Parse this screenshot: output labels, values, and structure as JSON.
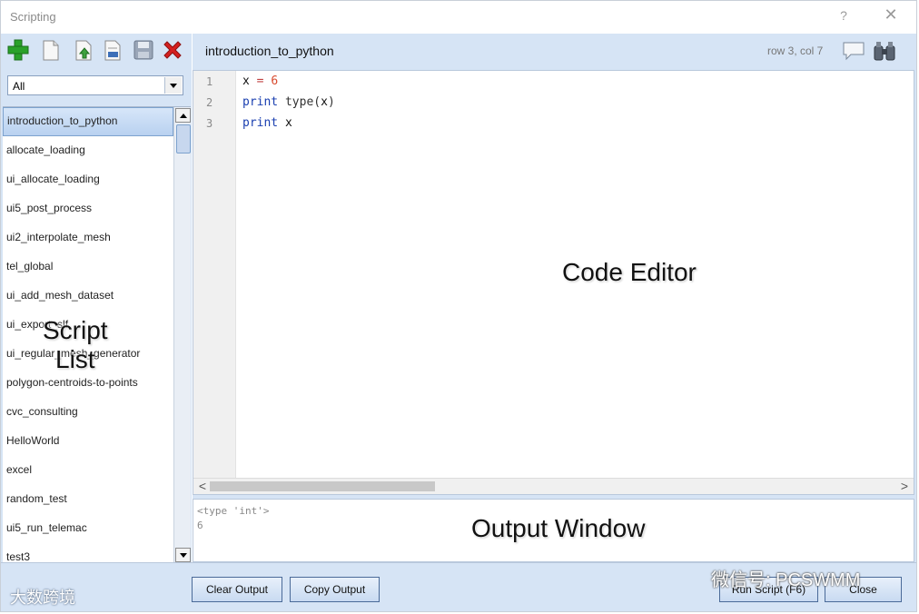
{
  "window": {
    "title": "Scripting",
    "help_glyph": "?",
    "close_glyph": "✕"
  },
  "toolbar": {
    "icons": [
      "add-icon",
      "new-file-icon",
      "import-icon",
      "script-file-icon",
      "save-icon",
      "delete-icon"
    ],
    "colors": {
      "add": "#2aa12a",
      "delete": "#d42020"
    }
  },
  "filter": {
    "value": "All"
  },
  "script_list": {
    "overlay_label_line1": "Script",
    "overlay_label_line2": "List",
    "items": [
      "introduction_to_python",
      "allocate_loading",
      "ui_allocate_loading",
      "ui5_post_process",
      "ui2_interpolate_mesh",
      "tel_global",
      "ui_add_mesh_dataset",
      "ui_export_slf",
      "ui_regular_mesh_generator",
      "polygon-centroids-to-points",
      "cvc_consulting",
      "HelloWorld",
      "excel",
      "random_test",
      "ui5_run_telemac",
      "test3"
    ]
  },
  "editor": {
    "script_name": "introduction_to_python",
    "cursor_position": "row 3, col 7",
    "overlay_label": "Code Editor",
    "line_numbers": [
      "1",
      "2",
      "3"
    ],
    "code_lines": [
      {
        "t1": "x",
        "t2": " = ",
        "t3": "6"
      },
      {
        "t1": "print",
        "t2": " type(",
        "t3": "x",
        "t4": ")"
      },
      {
        "t1": "print",
        "t2": " ",
        "t3": "x"
      }
    ],
    "scroll_left_glyph": "<",
    "scroll_right_glyph": ">"
  },
  "output": {
    "overlay_label": "Output Window",
    "lines": [
      "<type 'int'>",
      "6"
    ]
  },
  "buttons": {
    "clear_output": "Clear Output",
    "copy_output": "Copy Output",
    "run_script": "Run Script (F6)",
    "close": "Close"
  },
  "watermarks": {
    "left": "大数跨境",
    "right": "微信号: PCSWMM"
  },
  "colors": {
    "panel_bg": "#d6e4f5",
    "keyword": "#1a3fb0",
    "number": "#d84a2e"
  }
}
